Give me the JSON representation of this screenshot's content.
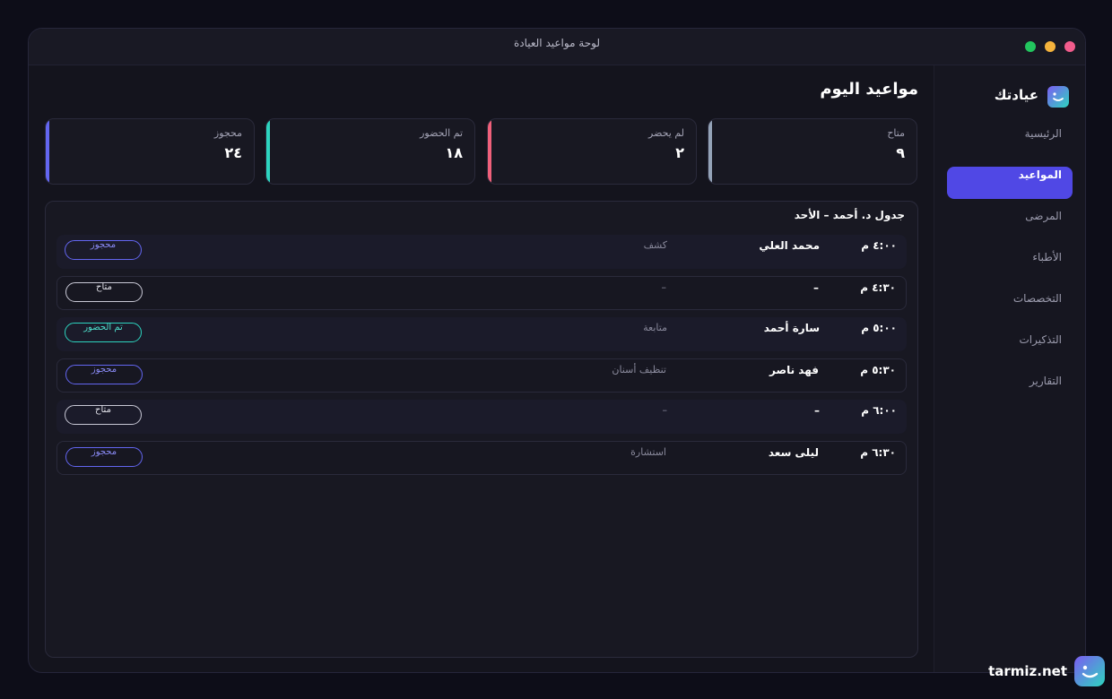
{
  "window": {
    "title": "لوحة مواعيد العيادة"
  },
  "colors": {
    "accent": "#5048e5",
    "available": "#94a3b8",
    "no_show": "#f0607a",
    "attended": "#2dd4bf",
    "booked": "#6366f1"
  },
  "sidebar": {
    "brand": "عيادتك",
    "brand_icon": "smile-logo-icon",
    "items": [
      {
        "label": "الرئيسية",
        "active": false
      },
      {
        "label": "المواعيد",
        "active": true
      },
      {
        "label": "المرضى",
        "active": false
      },
      {
        "label": "الأطباء",
        "active": false
      },
      {
        "label": "التخصصات",
        "active": false
      },
      {
        "label": "التذكيرات",
        "active": false
      },
      {
        "label": "التقارير",
        "active": false
      }
    ]
  },
  "main": {
    "title": "مواعيد اليوم",
    "stats": [
      {
        "label": "متاح",
        "value": "٩"
      },
      {
        "label": "لم يحضر",
        "value": "٢"
      },
      {
        "label": "تم الحضور",
        "value": "١٨"
      },
      {
        "label": "محجوز",
        "value": "٢٤"
      }
    ],
    "schedule": {
      "title": "جدول د. أحمد – الأحد",
      "rows": [
        {
          "time": "٤:٠٠ م",
          "patient": "محمد العلي",
          "service": "كشف",
          "status": "محجوز"
        },
        {
          "time": "٤:٣٠ م",
          "patient": "–",
          "service": "–",
          "status": "متاح"
        },
        {
          "time": "٥:٠٠ م",
          "patient": "سارة أحمد",
          "service": "متابعة",
          "status": "تم الحضور"
        },
        {
          "time": "٥:٣٠ م",
          "patient": "فهد ناصر",
          "service": "تنظيف أسنان",
          "status": "محجوز"
        },
        {
          "time": "٦:٠٠ م",
          "patient": "–",
          "service": "–",
          "status": "متاح"
        },
        {
          "time": "٦:٣٠ م",
          "patient": "ليلى سعد",
          "service": "استشارة",
          "status": "محجوز"
        }
      ]
    }
  },
  "footer": {
    "brand": "tarmiz.net",
    "icon": "smile-logo-icon"
  }
}
